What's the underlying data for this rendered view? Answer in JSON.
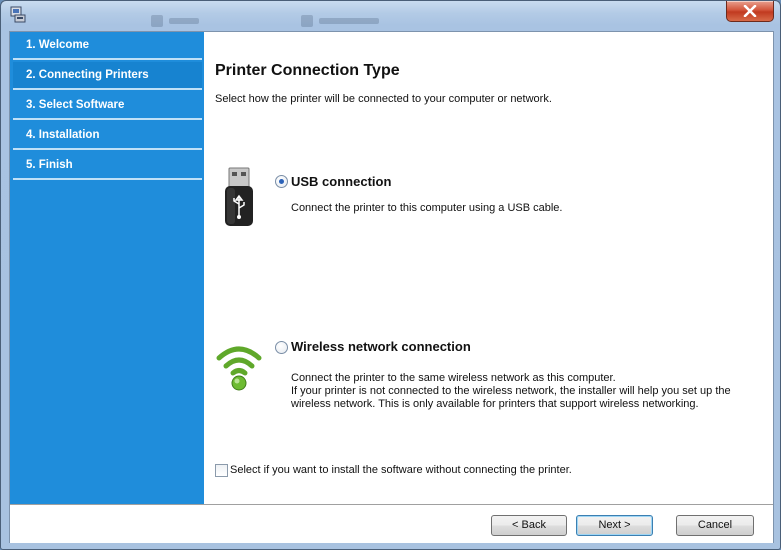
{
  "window": {
    "background_ghost_tab_1": "",
    "background_ghost_tab_2": ""
  },
  "sidebar": {
    "items": [
      {
        "label": "1. Welcome"
      },
      {
        "label": "2. Connecting Printers",
        "active": true
      },
      {
        "label": "3. Select Software"
      },
      {
        "label": "4. Installation"
      },
      {
        "label": "5. Finish"
      }
    ]
  },
  "main": {
    "title": "Printer Connection Type",
    "subtitle": "Select how the printer will be connected to your computer or network.",
    "options": [
      {
        "icon": "usb-drive-icon",
        "label": "USB connection",
        "selected": true,
        "description": [
          "Connect the printer to this computer using a USB cable."
        ]
      },
      {
        "icon": "wireless-signal-icon",
        "label": "Wireless network connection",
        "selected": false,
        "description": [
          "Connect the printer to the same wireless network as this computer.",
          "If your printer is not connected to the wireless network, the installer will help you set up the",
          "wireless network. This is only available for printers that support wireless networking."
        ]
      }
    ],
    "checkbox": {
      "label": "Select if you want to install the software without connecting the printer.",
      "checked": false
    }
  },
  "footer": {
    "back_label": "< Back",
    "next_label": "Next >",
    "cancel_label": "Cancel"
  },
  "colors": {
    "sidebar_blue": "#1f8ddb",
    "sidebar_divider": "#bfe0f7",
    "wifi_green": "#5fa82a",
    "radio_selected": "#2b62b8"
  }
}
